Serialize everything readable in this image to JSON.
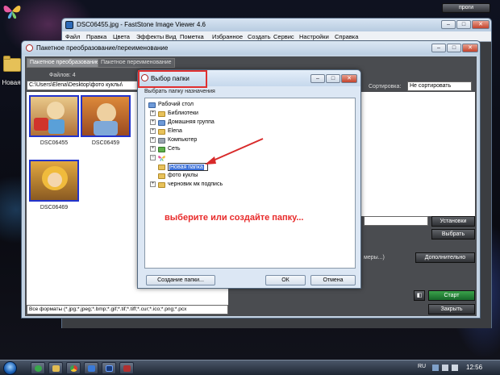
{
  "desktop": {
    "folder_label": "Новая"
  },
  "top_right": {
    "label": "проги"
  },
  "faststone": {
    "title": "DSC06455.jpg - FastStone Image Viewer 4.6",
    "menu": [
      "Файл",
      "Правка",
      "Цвета",
      "Эффекты",
      "Вид",
      "Пометка",
      "Избранное",
      "Создать",
      "Сервис",
      "Настройки",
      "Справка"
    ]
  },
  "batch": {
    "title": "Пакетное преобразование/переименование",
    "tabs": [
      "Пакетное преобразование",
      "Пакетное переименование"
    ],
    "files_label": "Файлов: 4",
    "path": "C:\\Users\\Elena\\Desktop\\фото куклы\\",
    "thumbnails": [
      {
        "caption": "DSC06455",
        "color": "#c98a3c"
      },
      {
        "caption": "DSC06459",
        "color": "#d27a3a"
      },
      {
        "caption": "DSC06469",
        "color": "#b9762e"
      }
    ],
    "format_filter": "Все форматы (*.jpg;*.jpeg;*.bmp;*.gif;*.tif;*.tiff;*.cur;*.ico;*.png;*.pcx",
    "sort_label": "Сортировка:",
    "sort_value": "Не сортировать",
    "install_button": "Установки",
    "choose_button": "Выбрать",
    "extra_text": "меры...)",
    "extra_button": "Дополнительно",
    "start_button": "Старт",
    "close_button": "Закрыть"
  },
  "chooser": {
    "title": "Выбор папки",
    "subtitle": "Выбрать папку назначения",
    "tree": [
      {
        "label": "Рабочий стол",
        "icon": "desktop-icon"
      },
      {
        "label": "Библиотеки",
        "icon": "libraries-icon"
      },
      {
        "label": "Домашняя группа",
        "icon": "homegroup-icon"
      },
      {
        "label": "Elena",
        "icon": "user-folder-icon"
      },
      {
        "label": "Компьютер",
        "icon": "computer-icon"
      },
      {
        "label": "Сеть",
        "icon": "network-icon"
      },
      {
        "label": "",
        "icon": "butterfly-icon"
      },
      {
        "label": "Новая папка",
        "icon": "folder-icon"
      },
      {
        "label": "фото куклы",
        "icon": "folder-icon"
      },
      {
        "label": "черновик мк подпись",
        "icon": "folder-icon"
      }
    ],
    "instruction": "выберите или создайте папку...",
    "create_button": "Создание папки...",
    "ok_button": "ОК",
    "cancel_button": "Отмена",
    "accent_red": "#e03030"
  },
  "taskbar": {
    "lang": "RU",
    "time": "12:56"
  }
}
